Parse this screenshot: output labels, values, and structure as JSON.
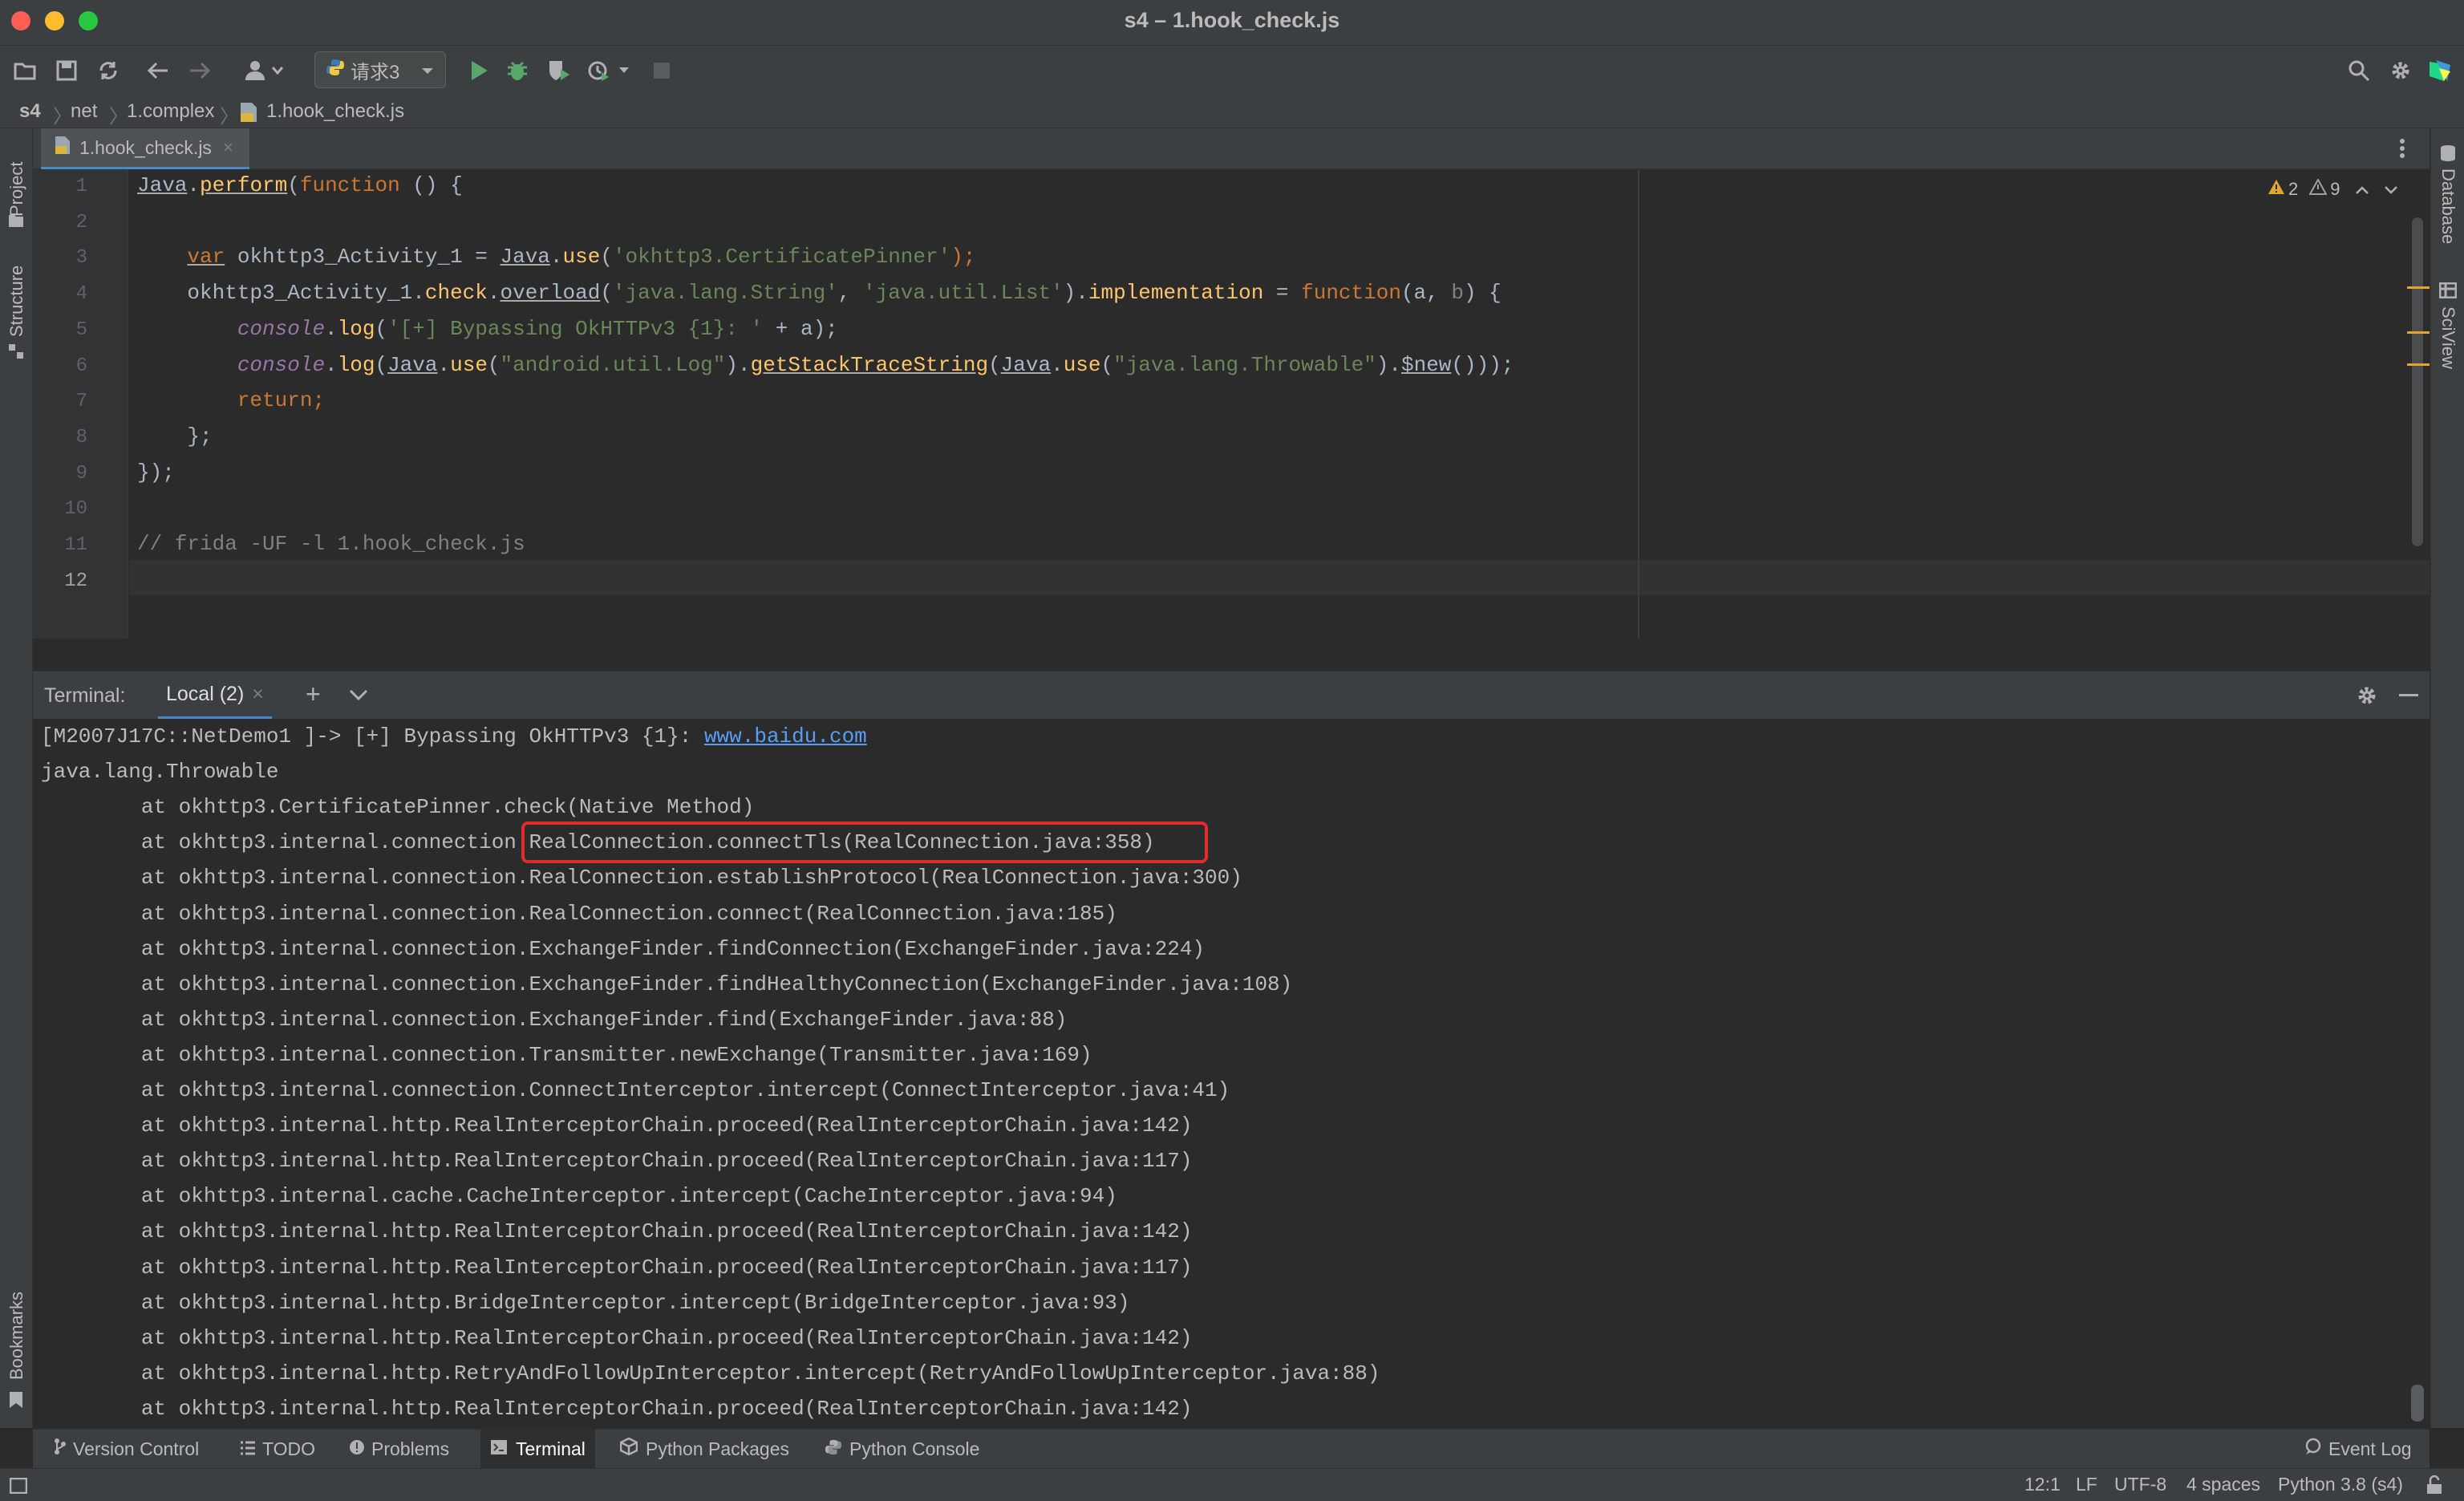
{
  "window": {
    "title": "s4 – 1.hook_check.js"
  },
  "toolbar": {
    "run_config": "请求3"
  },
  "breadcrumb": [
    "s4",
    "net",
    "1.complex",
    "1.hook_check.js"
  ],
  "left_stripe": {
    "project": "Project",
    "structure": "Structure",
    "bookmarks": "Bookmarks"
  },
  "right_stripe": {
    "database": "Database",
    "sciview": "SciView"
  },
  "editor": {
    "tab": "1.hook_check.js",
    "warnings_a": "2",
    "warnings_b": "9",
    "line_numbers": [
      "1",
      "2",
      "3",
      "4",
      "5",
      "6",
      "7",
      "8",
      "9",
      "10",
      "11",
      "12"
    ],
    "lines": [
      [
        {
          "t": "Java",
          "c": "ul"
        },
        {
          "t": "."
        },
        {
          "t": "perform",
          "c": "fn ul"
        },
        {
          "t": "("
        },
        {
          "t": "function",
          "c": "kw"
        },
        {
          "t": " () {"
        }
      ],
      [],
      [
        {
          "t": "    "
        },
        {
          "t": "var",
          "c": "kw ul"
        },
        {
          "t": " okhttp3_Activity_1 = "
        },
        {
          "t": "Java",
          "c": "ul"
        },
        {
          "t": "."
        },
        {
          "t": "use",
          "c": "fn"
        },
        {
          "t": "("
        },
        {
          "t": "'okhttp3.CertificatePinner'",
          "c": "str"
        },
        {
          "t": ");",
          "c": "kw"
        }
      ],
      [
        {
          "t": "    okhttp3_Activity_1."
        },
        {
          "t": "check",
          "c": "fn"
        },
        {
          "t": "."
        },
        {
          "t": "overload",
          "c": "ul"
        },
        {
          "t": "("
        },
        {
          "t": "'java.lang.String'",
          "c": "str"
        },
        {
          "t": ", "
        },
        {
          "t": "'java.util.List'",
          "c": "str"
        },
        {
          "t": ")."
        },
        {
          "t": "implementation",
          "c": "fn"
        },
        {
          "t": " = "
        },
        {
          "t": "function",
          "c": "kw"
        },
        {
          "t": "(a, "
        },
        {
          "t": "b",
          "c": "cm"
        },
        {
          "t": ") {"
        }
      ],
      [
        {
          "t": "        "
        },
        {
          "t": "console",
          "c": "it"
        },
        {
          "t": "."
        },
        {
          "t": "log",
          "c": "fn"
        },
        {
          "t": "("
        },
        {
          "t": "'[+] Bypassing OkHTTPv3 {1}: '",
          "c": "str"
        },
        {
          "t": " + a);"
        }
      ],
      [
        {
          "t": "        "
        },
        {
          "t": "console",
          "c": "it"
        },
        {
          "t": "."
        },
        {
          "t": "log",
          "c": "fn"
        },
        {
          "t": "("
        },
        {
          "t": "Java",
          "c": "ul"
        },
        {
          "t": "."
        },
        {
          "t": "use",
          "c": "fn"
        },
        {
          "t": "("
        },
        {
          "t": "\"android.util.Log\"",
          "c": "str"
        },
        {
          "t": ")."
        },
        {
          "t": "getStackTraceString",
          "c": "fn ul"
        },
        {
          "t": "("
        },
        {
          "t": "Java",
          "c": "ul"
        },
        {
          "t": "."
        },
        {
          "t": "use",
          "c": "fn"
        },
        {
          "t": "("
        },
        {
          "t": "\"java.lang.Throwable\"",
          "c": "str"
        },
        {
          "t": ")."
        },
        {
          "t": "$new",
          "c": "ul"
        },
        {
          "t": "()));"
        }
      ],
      [
        {
          "t": "        "
        },
        {
          "t": "return",
          "c": "kw"
        },
        {
          "t": ";",
          "c": "kw"
        }
      ],
      [
        {
          "t": "    };"
        }
      ],
      [
        {
          "t": "});"
        }
      ],
      [],
      [
        {
          "t": "// frida -UF -l 1.hook_check.js",
          "c": "cm"
        }
      ],
      []
    ]
  },
  "terminal": {
    "label": "Terminal:",
    "tab": "Local (2)",
    "prompt_prefix": "[M2007J17C::NetDemo1 ]-> [+] Bypassing OkHTTPv3 {1}: ",
    "prompt_link": "www.baidu.com",
    "output": [
      "java.lang.Throwable",
      "        at okhttp3.CertificatePinner.check(Native Method)",
      "        at okhttp3.internal.connection.RealConnection.connectTls(RealConnection.java:358)",
      "        at okhttp3.internal.connection.RealConnection.establishProtocol(RealConnection.java:300)",
      "        at okhttp3.internal.connection.RealConnection.connect(RealConnection.java:185)",
      "        at okhttp3.internal.connection.ExchangeFinder.findConnection(ExchangeFinder.java:224)",
      "        at okhttp3.internal.connection.ExchangeFinder.findHealthyConnection(ExchangeFinder.java:108)",
      "        at okhttp3.internal.connection.ExchangeFinder.find(ExchangeFinder.java:88)",
      "        at okhttp3.internal.connection.Transmitter.newExchange(Transmitter.java:169)",
      "        at okhttp3.internal.connection.ConnectInterceptor.intercept(ConnectInterceptor.java:41)",
      "        at okhttp3.internal.http.RealInterceptorChain.proceed(RealInterceptorChain.java:142)",
      "        at okhttp3.internal.http.RealInterceptorChain.proceed(RealInterceptorChain.java:117)",
      "        at okhttp3.internal.cache.CacheInterceptor.intercept(CacheInterceptor.java:94)",
      "        at okhttp3.internal.http.RealInterceptorChain.proceed(RealInterceptorChain.java:142)",
      "        at okhttp3.internal.http.RealInterceptorChain.proceed(RealInterceptorChain.java:117)",
      "        at okhttp3.internal.http.BridgeInterceptor.intercept(BridgeInterceptor.java:93)",
      "        at okhttp3.internal.http.RealInterceptorChain.proceed(RealInterceptorChain.java:142)",
      "        at okhttp3.internal.http.RetryAndFollowUpInterceptor.intercept(RetryAndFollowUpInterceptor.java:88)",
      "        at okhttp3.internal.http.RealInterceptorChain.proceed(RealInterceptorChain.java:142)"
    ]
  },
  "bottom_tools": {
    "version_control": "Version Control",
    "todo": "TODO",
    "problems": "Problems",
    "terminal": "Terminal",
    "python_packages": "Python Packages",
    "python_console": "Python Console",
    "event_log": "Event Log"
  },
  "status": {
    "position": "12:1",
    "line_sep": "LF",
    "encoding": "UTF-8",
    "indent": "4 spaces",
    "interpreter": "Python 3.8 (s4)"
  },
  "colors": {
    "accent": "#4a88c7",
    "highlight_box": "#e12a2a",
    "warning": "#e0a72b"
  }
}
